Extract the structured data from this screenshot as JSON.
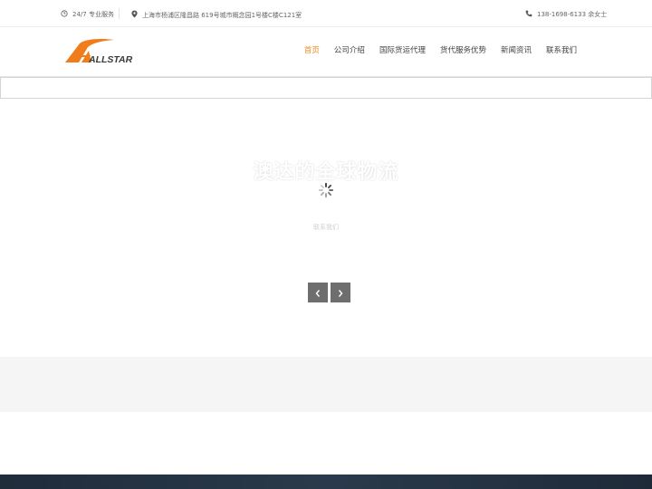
{
  "topbar": {
    "hours": "24/7 专业服务",
    "address": "上海市杨浦区隆昌路 619号城市概念园1号楼C楼C121室",
    "phone": "138-1698-6133 余女士"
  },
  "header": {
    "logo_text": "ALLSTAR",
    "nav": [
      {
        "label": "首页",
        "active": true
      },
      {
        "label": "公司介绍",
        "active": false
      },
      {
        "label": "国际货运代理",
        "active": false
      },
      {
        "label": "货代服务优势",
        "active": false
      },
      {
        "label": "新闻资讯",
        "active": false
      },
      {
        "label": "联系我们",
        "active": false
      }
    ]
  },
  "slider": {
    "title": "澳达的全球物流",
    "link": "联系我们"
  },
  "colors": {
    "accent": "#f28a21",
    "logo_orange": "#f07c1a",
    "logo_text": "#3a3a3a",
    "arrow_bg": "#6e6e6e",
    "footer_bg": "#24323f"
  }
}
